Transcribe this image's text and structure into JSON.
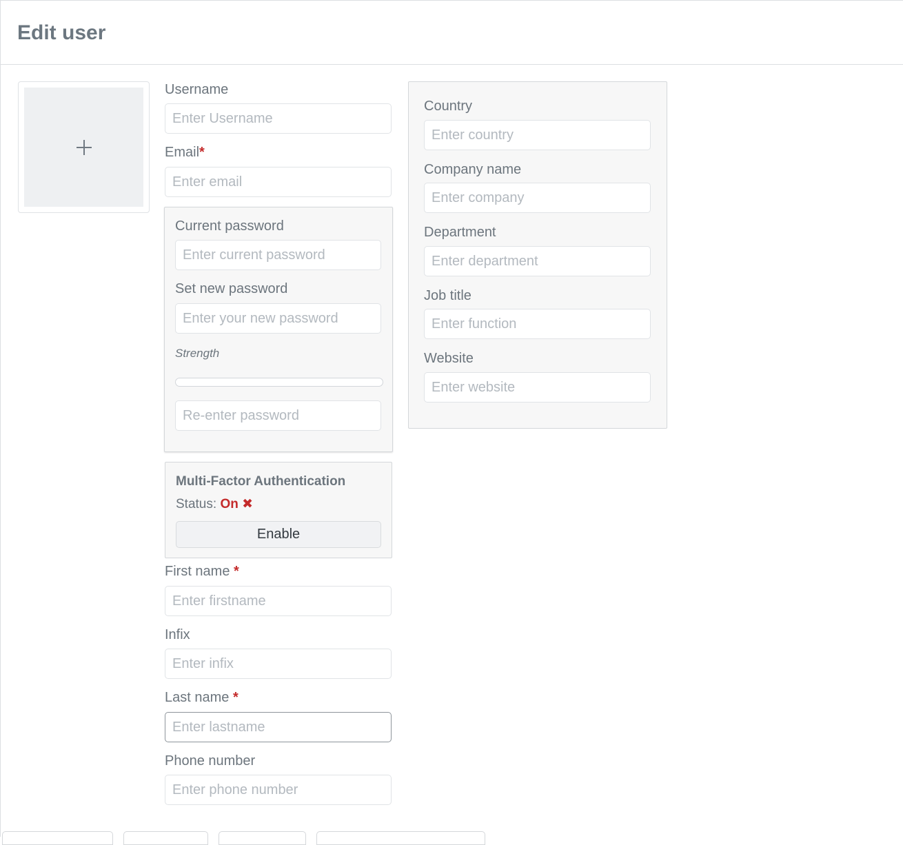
{
  "header": {
    "title": "Edit user"
  },
  "avatar": {
    "icon": "plus-icon"
  },
  "fields": {
    "username": {
      "label": "Username",
      "placeholder": "Enter Username"
    },
    "email": {
      "label": "Email",
      "required_mark": "*",
      "placeholder": "Enter email"
    },
    "first_name": {
      "label": "First name",
      "required_mark": "*",
      "placeholder": "Enter firstname"
    },
    "infix": {
      "label": "Infix",
      "placeholder": "Enter infix"
    },
    "last_name": {
      "label": "Last name",
      "required_mark": "*",
      "placeholder": "Enter lastname"
    },
    "phone": {
      "label": "Phone number",
      "placeholder": "Enter phone number"
    }
  },
  "password": {
    "current": {
      "label": "Current password",
      "placeholder": "Enter current password"
    },
    "new": {
      "label": "Set new password",
      "placeholder": "Enter your new password"
    },
    "strength_label": "Strength",
    "strength_value": 0,
    "reenter": {
      "placeholder": "Re-enter password"
    }
  },
  "mfa": {
    "title": "Multi-Factor Authentication",
    "status_label": "Status:",
    "status_value": "On",
    "status_icon": "x-mark-icon",
    "status_color": "#c42b2b",
    "enable_label": "Enable"
  },
  "company": {
    "country": {
      "label": "Country",
      "placeholder": "Enter country"
    },
    "company_name": {
      "label": "Company name",
      "placeholder": "Enter company"
    },
    "department": {
      "label": "Department",
      "placeholder": "Enter department"
    },
    "job_title": {
      "label": "Job title",
      "placeholder": "Enter function"
    },
    "website": {
      "label": "Website",
      "placeholder": "Enter website"
    }
  }
}
